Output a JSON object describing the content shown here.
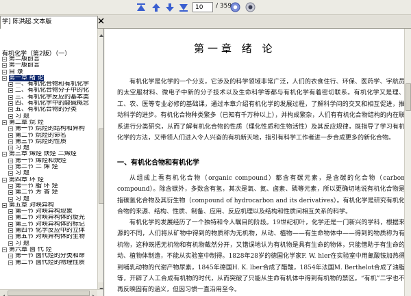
{
  "toolbar": {
    "page_current": "10",
    "page_total": "/ 359",
    "icons": [
      "first-page-icon",
      "prev-page-icon",
      "next-page-icon",
      "last-page-icon",
      "go-icon",
      "stop-icon"
    ],
    "icon_color": "#3a5fd0"
  },
  "tab": {
    "label": "学] 陈洪超.文本版"
  },
  "outline": {
    "root": "有机化学（第2版）（一）",
    "items": [
      {
        "label": "第二版前言",
        "level": 1,
        "sign": "minus"
      },
      {
        "label": "第一版前言",
        "level": 1,
        "sign": "minus"
      },
      {
        "label": "目    录",
        "level": 1,
        "sign": "minus"
      },
      {
        "label": "第一章  绪    论",
        "level": 1,
        "sign": "minus",
        "selected": true
      },
      {
        "label": "一、有机化合物和有机化学",
        "level": 2,
        "sign": "minus"
      },
      {
        "label": "二、有机化合物分子中的化",
        "level": 2,
        "sign": "minus"
      },
      {
        "label": "三、有机化学反应的基本类",
        "level": 2,
        "sign": "minus"
      },
      {
        "label": "四、有机化学中的酸碱概念",
        "level": 2,
        "sign": "minus"
      },
      {
        "label": "五、有机化合物的分类",
        "level": 2,
        "sign": "minus"
      },
      {
        "label": "习    题",
        "level": 2,
        "sign": "minus"
      },
      {
        "label": "第二章  烷    烃",
        "level": 1,
        "sign": "minus"
      },
      {
        "label": "第一节  烷烃的结构和异构",
        "level": 2,
        "sign": "minus"
      },
      {
        "label": "第二节  烷烃的命名",
        "level": 2,
        "sign": "minus"
      },
      {
        "label": "第三节  烷烃的性质",
        "level": 2,
        "sign": "minus"
      },
      {
        "label": "习    题",
        "level": 2,
        "sign": "minus"
      },
      {
        "label": "第三章  烯烃  炔烃  二烯烃",
        "level": 1,
        "sign": "minus"
      },
      {
        "label": "第一节  烯烃和炔烃",
        "level": 2,
        "sign": "minus"
      },
      {
        "label": "第二节  二    烯    烃",
        "level": 2,
        "sign": "minus"
      },
      {
        "label": "习    题",
        "level": 2,
        "sign": "minus"
      },
      {
        "label": "第四章  环    烃",
        "level": 1,
        "sign": "minus"
      },
      {
        "label": "第一节  脂    环    烃",
        "level": 2,
        "sign": "minus"
      },
      {
        "label": "第二节  芳    香    烃",
        "level": 2,
        "sign": "minus"
      },
      {
        "label": "习    题",
        "level": 2,
        "sign": "minus"
      },
      {
        "label": "第五章  对映异构",
        "level": 1,
        "sign": "minus"
      },
      {
        "label": "第一节  对映异构现象",
        "level": 2,
        "sign": "minus"
      },
      {
        "label": "第二节  对映异构体的旋光",
        "level": 2,
        "sign": "minus"
      },
      {
        "label": "第三节  对映异构体的标记",
        "level": 2,
        "sign": "minus"
      },
      {
        "label": "第四节  化学反应中的立体",
        "level": 2,
        "sign": "minus"
      },
      {
        "label": "第五节  对映异构体的生物",
        "level": 2,
        "sign": "minus"
      },
      {
        "label": "习    题",
        "level": 2,
        "sign": "minus"
      },
      {
        "label": "第六章  卤  代  烃",
        "level": 1,
        "sign": "minus"
      },
      {
        "label": "第一节  卤代烃的分类和命",
        "level": 2,
        "sign": "minus"
      },
      {
        "label": "第二节  卤代烃的物理性质",
        "level": 2,
        "sign": "minus"
      }
    ]
  },
  "document": {
    "title": "第一章  绪      论",
    "para1": "有机化学是化学的一个分支，它涉及的科学领域非常广泛，人们的衣食住行、环保、医药学、宇航员的太空服材料、微电子中新的分子技术以及生命科学等都与有机化学有着密切联系。有机化学又是理、工、农、医等专业必修的基础课，通过本章介绍有机化学的发展过程，了解科学间的交叉和相互促进，推动科学的进步。有机化合物种类繁多（已知有千万种以上），并构成繁杂，人们有有机化合物结构的内在联系进行分类研究，从而了解有机化合物的性质（理化性质和生物活性）及其反应规律，既指导了学习有机化学的方法，又带领人们进入令人兴奋的有机新天地，指引有科学工作者进一步合成更多的新化合物。",
    "section1": "一、有机化合物和有机化学",
    "para2": "从组成上看有机化合物（organic compound）都含有碳元素，是含碳的化合物（carbon compound）。除含碳外，多数含有氢，其次是氧、氮、卤素、磷等元素，所以更确切地说有机化合物是指碳氢化合物及其衍生物（compound of hydrocarbon and its derivatives）。有机化学是研究有机化合物的来源、结构、性质、制备、应用、反应机理以及结构和性质间相互关系的科学。",
    "para3": "有机化学的发展经历了一个独特和令人瞩目的阶段。19世纪初叶，化学还是一门新兴的学科，根据来源的不同，人们将从矿物中得到的物质称为无机物，从动、植物——有生命物体中——得到的物质称为有机物，这种既把无机物和有机物截然分开，又错误地认为有机物是具有生命的物体，只能借助于有生命的动、植物体制造，不能从实验室中制得。1828年28岁的德国化学家F. W. hler在实验室中用氰酸铵加热得到哺乳动物的代谢产物尿素，1845年德国H. K. lber合成了醋酸，1854年法国M. Berthelot合成了油脂等，开辟了人工合成有机物的时代，从而突破了只能从生命有机体中得到有机物的禁区。“有机”二字也不再反映固有的涵义，但因习惯一直沿用至今。"
  }
}
